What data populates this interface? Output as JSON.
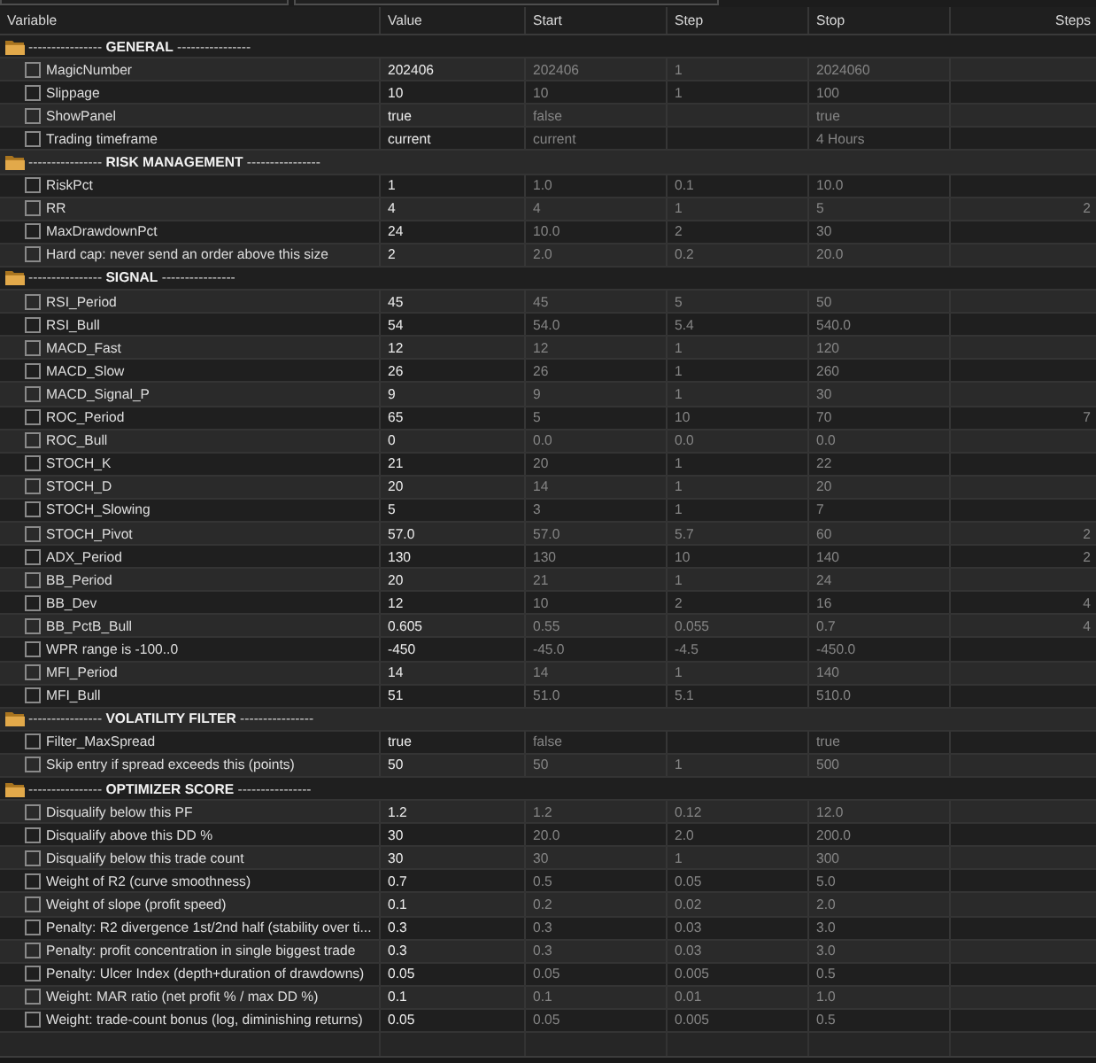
{
  "columns": [
    "Variable",
    "Value",
    "Start",
    "Step",
    "Stop",
    "Steps"
  ],
  "sections": [
    {
      "title": "---------------- **GENERAL** ----------------",
      "params": [
        {
          "name": "MagicNumber",
          "checked": false,
          "value": "202406",
          "start": "202406",
          "step": "1",
          "stop": "2024060"
        },
        {
          "name": "Slippage",
          "checked": false,
          "value": "10",
          "start": "10",
          "step": "1",
          "stop": "100"
        },
        {
          "name": "ShowPanel",
          "checked": false,
          "value": "true",
          "start": "false",
          "stop": "true"
        },
        {
          "name": "Trading timeframe",
          "checked": false,
          "value": "current",
          "start": "current",
          "stop": "4 Hours"
        }
      ]
    },
    {
      "title": "---------------- **RISK MANAGEMENT** ----------------",
      "params": [
        {
          "name": "RiskPct",
          "checked": false,
          "value": "1",
          "start": "1.0",
          "step": "0.1",
          "stop": "10.0"
        },
        {
          "name": "RR",
          "checked": false,
          "value": "4",
          "start": "4",
          "step": "1",
          "stop": "5",
          "steps": "2"
        },
        {
          "name": "MaxDrawdownPct",
          "checked": false,
          "value": "24",
          "start": "10.0",
          "step": "2",
          "stop": "30"
        },
        {
          "name": "Hard cap: never send an order above this size",
          "checked": false,
          "value": "2",
          "start": "2.0",
          "step": "0.2",
          "stop": "20.0"
        }
      ]
    },
    {
      "title": "---------------- **SIGNAL** ----------------",
      "params": [
        {
          "name": "RSI_Period",
          "checked": false,
          "value": "45",
          "start": "45",
          "step": "5",
          "stop": "50"
        },
        {
          "name": "RSI_Bull",
          "checked": false,
          "value": "54",
          "start": "54.0",
          "step": "5.4",
          "stop": "540.0"
        },
        {
          "name": "MACD_Fast",
          "checked": false,
          "value": "12",
          "start": "12",
          "step": "1",
          "stop": "120"
        },
        {
          "name": "MACD_Slow",
          "checked": false,
          "value": "26",
          "start": "26",
          "step": "1",
          "stop": "260"
        },
        {
          "name": "MACD_Signal_P",
          "checked": false,
          "value": "9",
          "start": "9",
          "step": "1",
          "stop": "30"
        },
        {
          "name": "ROC_Period",
          "checked": false,
          "value": "65",
          "start": "5",
          "step": "10",
          "stop": "70",
          "steps": "7"
        },
        {
          "name": "ROC_Bull",
          "checked": false,
          "value": "0",
          "start": "0.0",
          "step": "0.0",
          "stop": "0.0"
        },
        {
          "name": "STOCH_K",
          "checked": false,
          "value": "21",
          "start": "20",
          "step": "1",
          "stop": "22"
        },
        {
          "name": "STOCH_D",
          "checked": false,
          "value": "20",
          "start": "14",
          "step": "1",
          "stop": "20"
        },
        {
          "name": "STOCH_Slowing",
          "checked": false,
          "value": "5",
          "start": "3",
          "step": "1",
          "stop": "7"
        },
        {
          "name": "STOCH_Pivot",
          "checked": false,
          "value": "57.0",
          "start": "57.0",
          "step": "5.7",
          "stop": "60",
          "steps": "2"
        },
        {
          "name": "ADX_Period",
          "checked": false,
          "value": "130",
          "start": "130",
          "step": "10",
          "stop": "140",
          "steps": "2"
        },
        {
          "name": "BB_Period",
          "checked": false,
          "value": "20",
          "start": "21",
          "step": "1",
          "stop": "24"
        },
        {
          "name": "BB_Dev",
          "checked": false,
          "value": "12",
          "start": "10",
          "step": "2",
          "stop": "16",
          "steps": "4"
        },
        {
          "name": "BB_PctB_Bull",
          "checked": false,
          "value": "0.605",
          "start": "0.55",
          "step": "0.055",
          "stop": "0.7",
          "steps": "4"
        },
        {
          "name": "WPR range is -100..0",
          "checked": false,
          "value": "-450",
          "start": "-45.0",
          "step": "-4.5",
          "stop": "-450.0"
        },
        {
          "name": "MFI_Period",
          "checked": false,
          "value": "14",
          "start": "14",
          "step": "1",
          "stop": "140"
        },
        {
          "name": "MFI_Bull",
          "checked": false,
          "value": "51",
          "start": "51.0",
          "step": "5.1",
          "stop": "510.0"
        }
      ]
    },
    {
      "title": "---------------- **VOLATILITY FILTER** ----------------",
      "params": [
        {
          "name": "Filter_MaxSpread",
          "checked": false,
          "value": "true",
          "start": "false",
          "stop": "true"
        },
        {
          "name": "Skip entry if spread exceeds this (points)",
          "checked": false,
          "value": "50",
          "start": "50",
          "step": "1",
          "stop": "500"
        }
      ]
    },
    {
      "title": "---------------- **OPTIMIZER SCORE** ----------------",
      "params": [
        {
          "name": "Disqualify below this PF",
          "checked": false,
          "value": "1.2",
          "start": "1.2",
          "step": "0.12",
          "stop": "12.0"
        },
        {
          "name": "Disqualify above this DD %",
          "checked": false,
          "value": "30",
          "start": "20.0",
          "step": "2.0",
          "stop": "200.0"
        },
        {
          "name": "Disqualify below this trade count",
          "checked": false,
          "value": "30",
          "start": "30",
          "step": "1",
          "stop": "300"
        },
        {
          "name": "Weight of R2 (curve smoothness)",
          "checked": false,
          "value": "0.7",
          "start": "0.5",
          "step": "0.05",
          "stop": "5.0"
        },
        {
          "name": "Weight of slope (profit speed)",
          "checked": false,
          "value": "0.1",
          "start": "0.2",
          "step": "0.02",
          "stop": "2.0"
        },
        {
          "name": "Penalty: R2 divergence 1st/2nd half (stability over ti...",
          "checked": false,
          "value": "0.3",
          "start": "0.3",
          "step": "0.03",
          "stop": "3.0"
        },
        {
          "name": "Penalty: profit concentration in single biggest trade",
          "checked": false,
          "value": "0.3",
          "start": "0.3",
          "step": "0.03",
          "stop": "3.0"
        },
        {
          "name": "Penalty: Ulcer Index (depth+duration of drawdowns)",
          "checked": false,
          "value": "0.05",
          "start": "0.05",
          "step": "0.005",
          "stop": "0.5"
        },
        {
          "name": "Weight: MAR ratio (net profit % / max DD %)",
          "checked": false,
          "value": "0.1",
          "start": "0.1",
          "step": "0.01",
          "stop": "1.0"
        },
        {
          "name": "Weight: trade-count bonus (log, diminishing returns)",
          "checked": false,
          "value": "0.05",
          "start": "0.05",
          "step": "0.005",
          "stop": "0.5"
        }
      ]
    }
  ]
}
